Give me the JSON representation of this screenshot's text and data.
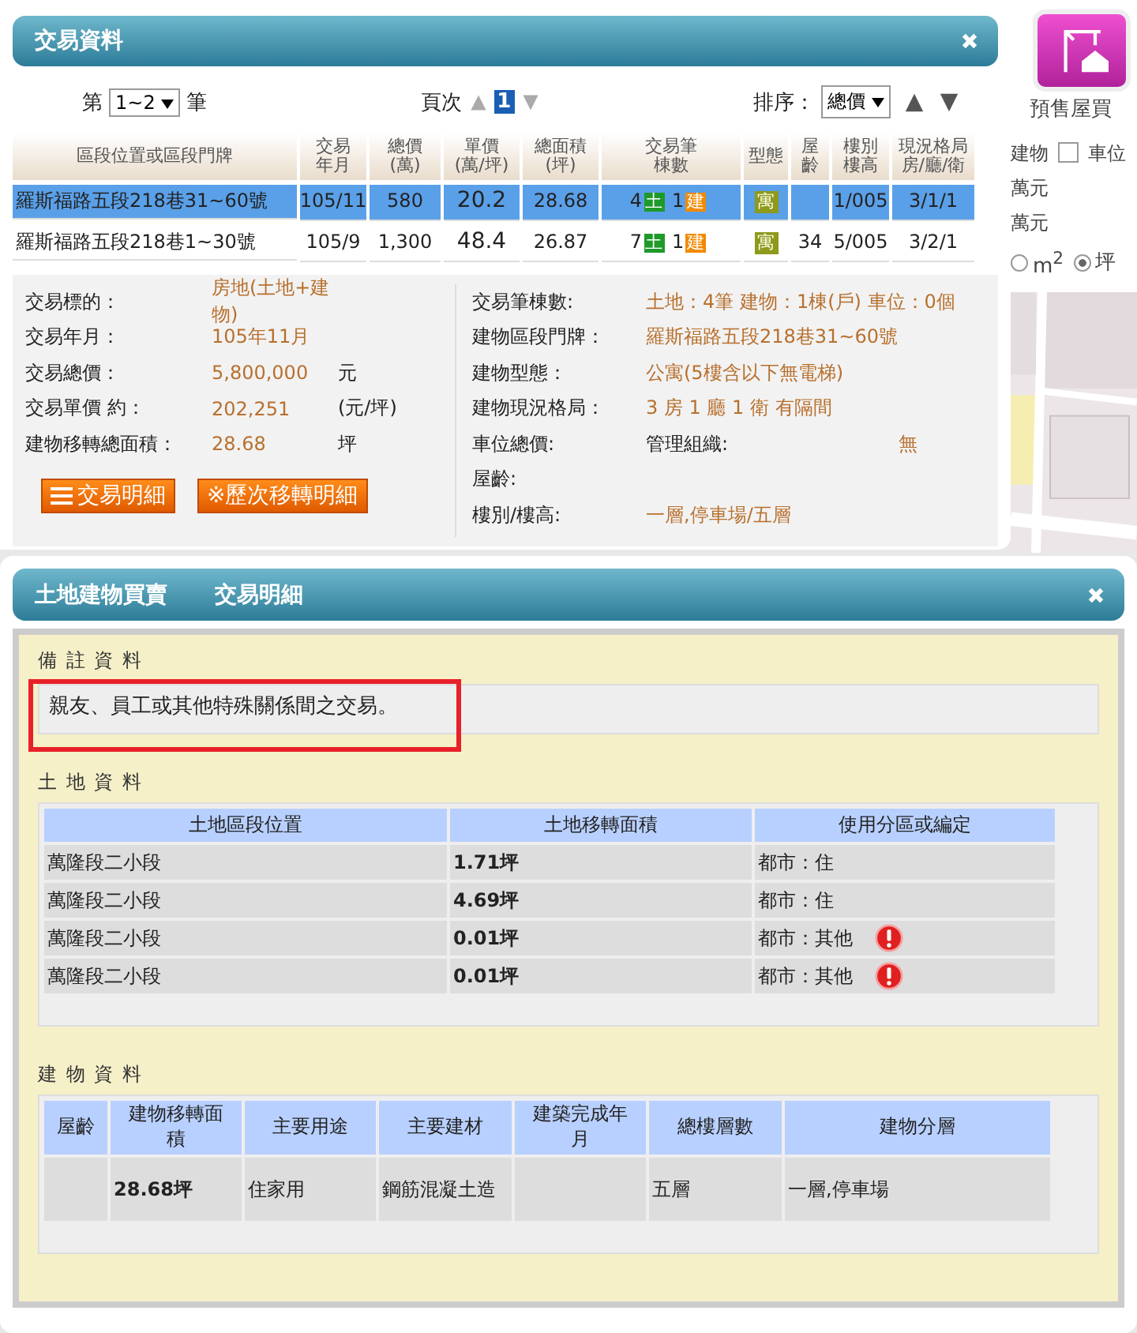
{
  "side_panel": {
    "app_label": "預售屋買",
    "filters": [
      {
        "label": "建物",
        "kind": "text"
      },
      {
        "label": "車位",
        "kind": "checkbox",
        "checked": false
      }
    ],
    "units": [
      "萬元",
      "萬元"
    ],
    "area_units": [
      {
        "label": "m",
        "sup": "2",
        "selected": false
      },
      {
        "label": "坪",
        "selected": true
      }
    ],
    "map": {
      "kind": "picture"
    }
  },
  "transactions": {
    "title": "交易資料",
    "range": {
      "prefix": "第",
      "value": "1~2",
      "suffix": "筆"
    },
    "page": {
      "label": "頁次",
      "value": "1"
    },
    "sort": {
      "label": "排序：",
      "value": "總價"
    },
    "columns": [
      "區段位置或區段門牌",
      "交易年月",
      "總價(萬)",
      "單價(萬/坪)",
      "總面積(坪)",
      "交易筆棟數",
      "型態",
      "屋齡",
      "樓別樓高",
      "現況格局房/廳/衛"
    ],
    "rows": [
      {
        "location": "羅斯福路五段218巷31~60號",
        "date": "105/11",
        "total": "580",
        "unit_price": "20.2",
        "area": "28.68",
        "land_count": "4",
        "land_tag": "土",
        "building_count": "1",
        "building_tag": "建",
        "type": "寓",
        "age": "",
        "floor": "1/005",
        "layout": "3/1/1",
        "selected": true
      },
      {
        "location": "羅斯福路五段218巷1~30號",
        "date": "105/9",
        "total": "1,300",
        "unit_price": "48.4",
        "area": "26.87",
        "land_count": "7",
        "land_tag": "土",
        "building_count": "1",
        "building_tag": "建",
        "type": "寓",
        "age": "34",
        "floor": "5/005",
        "layout": "3/2/1",
        "selected": false
      }
    ],
    "details_left": [
      {
        "label": "交易標的：",
        "value": "房地(土地+建物)"
      },
      {
        "label": "交易年月：",
        "value": "105年11月"
      },
      {
        "label": "交易總價：",
        "value": "5,800,000",
        "unit": "元"
      },
      {
        "label": "交易單價 約：",
        "value": "202,251",
        "unit": "(元/坪)"
      },
      {
        "label": "建物移轉總面積：",
        "value": "28.68",
        "unit": "坪"
      }
    ],
    "details_right": [
      {
        "label": "交易筆棟數:",
        "value": "土地：4筆 建物：1棟(戶) 車位：0個"
      },
      {
        "label": "建物區段門牌：",
        "value": "羅斯福路五段218巷31~60號"
      },
      {
        "label": "建物型態：",
        "value": "公寓(5樓含以下無電梯)"
      },
      {
        "label": "建物現況格局：",
        "value": "3 房 1 廳 1 衛 有隔間"
      },
      {
        "label": "車位總價:",
        "extra_label": "管理組織:",
        "extra_value": "無"
      },
      {
        "label": "屋齡:"
      },
      {
        "label": "樓別/樓高:",
        "value": "一層,停車場/五層"
      }
    ],
    "buttons": [
      {
        "label": "交易明細",
        "kind": "menu"
      },
      {
        "label": "※歷次移轉明細",
        "kind": "plain"
      }
    ]
  },
  "detail": {
    "title_parts": [
      "土地建物買賣",
      "交易明細"
    ],
    "remarks": {
      "heading": "備 註 資 料",
      "text": "親友、員工或其他特殊關係間之交易。",
      "highlighted": true
    },
    "land": {
      "heading": "土 地 資 料",
      "columns": [
        "土地區段位置",
        "土地移轉面積",
        "使用分區或編定"
      ],
      "rows": [
        {
          "section": "萬隆段二小段",
          "area": "1.71坪",
          "zoning": "都市：住",
          "alert": false
        },
        {
          "section": "萬隆段二小段",
          "area": "4.69坪",
          "zoning": "都市：住",
          "alert": false
        },
        {
          "section": "萬隆段二小段",
          "area": "0.01坪",
          "zoning": "都市：其他",
          "alert": true
        },
        {
          "section": "萬隆段二小段",
          "area": "0.01坪",
          "zoning": "都市：其他",
          "alert": true
        }
      ]
    },
    "building": {
      "heading": "建 物 資 料",
      "columns": [
        "屋齡",
        "建物移轉面積",
        "主要用途",
        "主要建材",
        "建築完成年月",
        "總樓層數",
        "建物分層"
      ],
      "rows": [
        [
          null,
          "28.68坪",
          "住家用",
          "鋼筋混凝土造",
          null,
          "五層",
          "一層,停車場"
        ]
      ]
    }
  }
}
